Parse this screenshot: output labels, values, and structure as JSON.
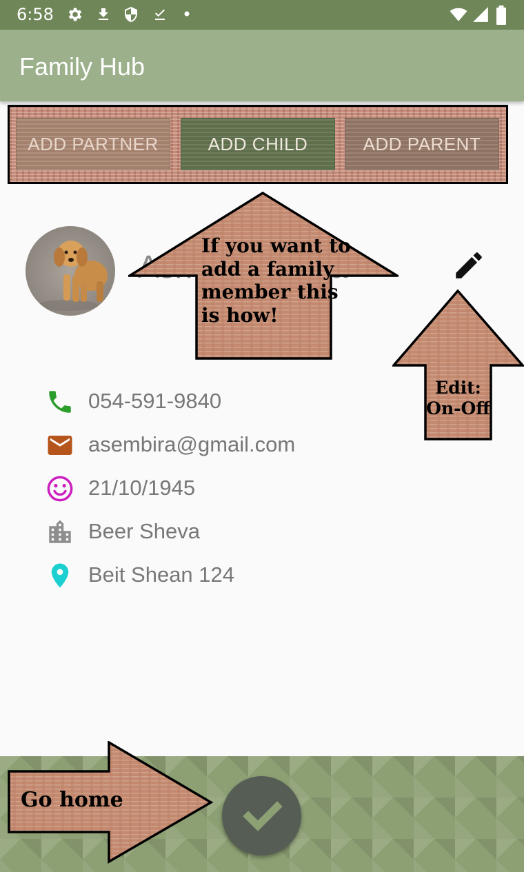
{
  "status_bar": {
    "time": "6:58",
    "icons": [
      "gear-icon",
      "download-icon",
      "shield-icon",
      "download-done-icon",
      "dot-icon",
      "wifi-icon",
      "cell-signal-icon",
      "battery-icon"
    ]
  },
  "app_bar": {
    "title": "Family Hub"
  },
  "actions": {
    "add_partner": "ADD PARTNER",
    "add_child": "ADD CHILD",
    "add_parent": "ADD PARENT"
  },
  "profile": {
    "name": "Asher Sembira",
    "phone": "054-591-9840",
    "email": "asembira@gmail.com",
    "birth_date": "21/10/1945",
    "city": "Beer Sheva",
    "address": "Beit Shean 124"
  },
  "callouts": {
    "add_member_line1": "If you want to",
    "add_member_line2": "add a family",
    "add_member_line3": "member this",
    "add_member_line4": "is how!",
    "edit_line1": "Edit:",
    "edit_line2": "On-Off",
    "home": "Go home"
  },
  "colors": {
    "status_bar": "#6f8658",
    "app_bar": "#9bb08b",
    "phone_icon": "#2a9d2a",
    "email_icon": "#b5541b",
    "birthday_icon": "#cc1fbf",
    "city_icon": "#8e8e8e",
    "location_icon": "#1ccfd0",
    "callout_fill": "#c48a70"
  }
}
